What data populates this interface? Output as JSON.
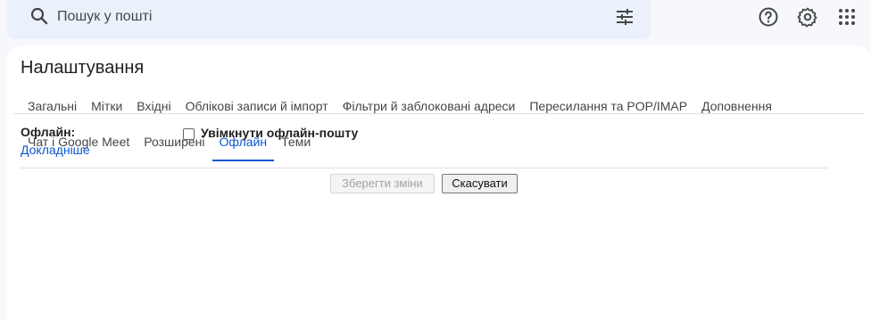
{
  "search": {
    "placeholder": "Пошук у пошті",
    "icon": "search-icon",
    "options_icon": "tune-icon"
  },
  "header_icons": [
    "help-icon",
    "gear-icon",
    "apps-icon"
  ],
  "settings": {
    "title": "Налаштування",
    "tabs_row1": [
      {
        "label": "Загальні"
      },
      {
        "label": "Мітки"
      },
      {
        "label": "Вхідні"
      },
      {
        "label": "Облікові записи й імпорт"
      },
      {
        "label": "Фільтри й заблоковані адреси"
      },
      {
        "label": "Пересилання та POP/IMAP"
      },
      {
        "label": "Доповнення"
      }
    ],
    "tabs_row2": [
      {
        "label": "Чат і Google Meet"
      },
      {
        "label": "Розширені"
      },
      {
        "label": "Офлайн",
        "active": true
      },
      {
        "label": "Теми"
      }
    ],
    "offline": {
      "label": "Офлайн:",
      "learn_more": "Докладніше",
      "checkbox_label": "Увімкнути офлайн-пошту",
      "checked": false
    },
    "buttons": {
      "save": "Зберегти зміни",
      "cancel": "Скасувати"
    }
  },
  "colors": {
    "accent": "#0b57d0",
    "search_bg": "#eaf1fb",
    "page_bg": "#f6f8fc"
  }
}
